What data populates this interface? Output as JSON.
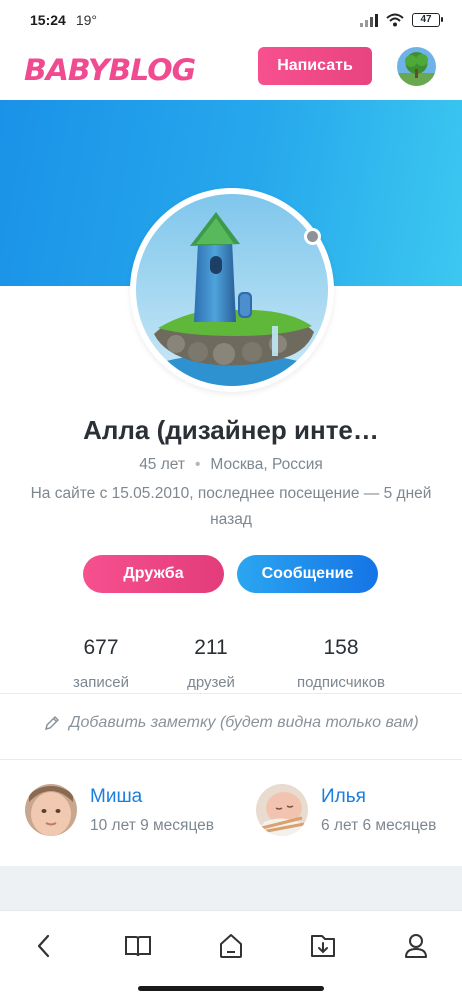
{
  "status": {
    "time": "15:24",
    "temp": "19°",
    "battery": "47"
  },
  "header": {
    "logo": "BABYBLOG",
    "write_label": "Написать"
  },
  "profile": {
    "name": "Алла (дизайнер инте…",
    "age": "45 лет",
    "location": "Москва, Россия",
    "since": "На сайте с 15.05.2010, последнее посещение — 5 дней назад"
  },
  "actions": {
    "friend_label": "Дружба",
    "message_label": "Сообщение"
  },
  "stats": [
    {
      "value": "677",
      "label": "записей"
    },
    {
      "value": "211",
      "label": "друзей"
    },
    {
      "value": "158",
      "label": "подписчиков"
    }
  ],
  "note": {
    "text": "Добавить заметку (будет видна только вам)"
  },
  "children": [
    {
      "name": "Миша",
      "age": "10 лет 9 месяцев"
    },
    {
      "name": "Илья",
      "age": "6 лет 6 месяцев"
    }
  ],
  "bottom_nav": [
    "back-icon",
    "book-icon",
    "home-icon",
    "download-icon",
    "profile-icon"
  ],
  "colors": {
    "brand_pink": "#f04a90",
    "accent_blue": "#1a7ee0"
  }
}
